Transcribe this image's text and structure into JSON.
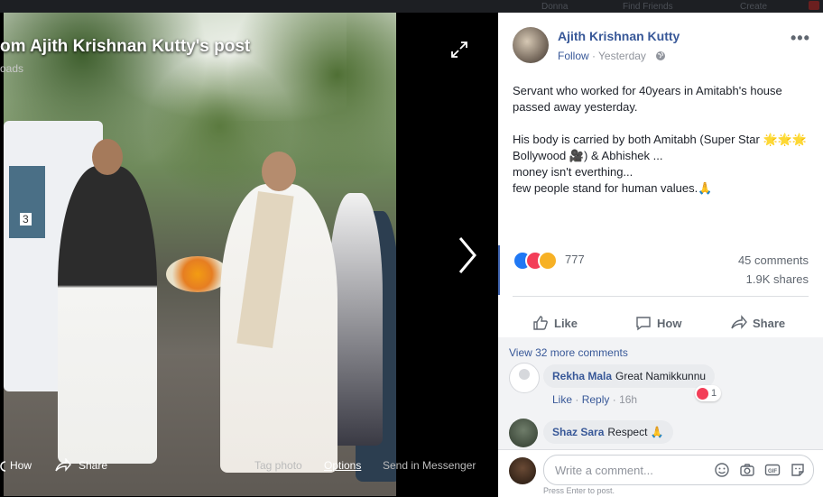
{
  "topbar": {
    "items": [
      "Donna",
      "Find Friends",
      "Create"
    ]
  },
  "viewer": {
    "title": "om Ajith Krishnan Kutty's post",
    "subtitle": "oads",
    "photo_van_number": "3",
    "bottom": {
      "how_label": "How",
      "share_label": "Share",
      "tag_photo_label": "Tag photo",
      "options_label": "Options",
      "send_messenger_label": "Send in Messenger"
    }
  },
  "post": {
    "author": "Ajith Krishnan Kutty",
    "follow_label": "Follow",
    "separator": "·",
    "time": "Yesterday",
    "paragraphs": [
      "Servant who worked for 40years in Amitabh's house passed away yesterday.",
      "His body is carried by both Amitabh (Super Star 🌟🌟🌟 Bollywood 🎥) & Abhishek ...",
      "money isn't everthing...",
      "few people stand for human values.🙏"
    ],
    "reaction_count": "777",
    "comments_count": "45 comments",
    "shares_count": "1.9K shares",
    "actions": {
      "like": "Like",
      "how": "How",
      "share": "Share"
    }
  },
  "comments": {
    "view_more": "View 32 more comments",
    "items": [
      {
        "name": "Rekha Mala",
        "text": "Great Namikkunnu",
        "like": "Like",
        "reply": "Reply",
        "time": "16h",
        "reaction_count": "1"
      },
      {
        "name": "Shaz Sara",
        "text": "Respect 🙏"
      }
    ]
  },
  "compose": {
    "placeholder": "Write a comment...",
    "hint": "Press Enter to post.",
    "gif_label": "GIF"
  },
  "colors": {
    "link": "#385898",
    "like_blue": "#2078f4",
    "love_red": "#f33e58",
    "sad_yellow": "#f7b125"
  },
  "icons": [
    "expand-icon",
    "next-arrow-icon",
    "share-arrow-icon",
    "globe-icon",
    "more-icon",
    "thumbs-up-icon",
    "comment-icon",
    "emoji-icon",
    "camera-icon",
    "gif-icon",
    "sticker-icon"
  ]
}
